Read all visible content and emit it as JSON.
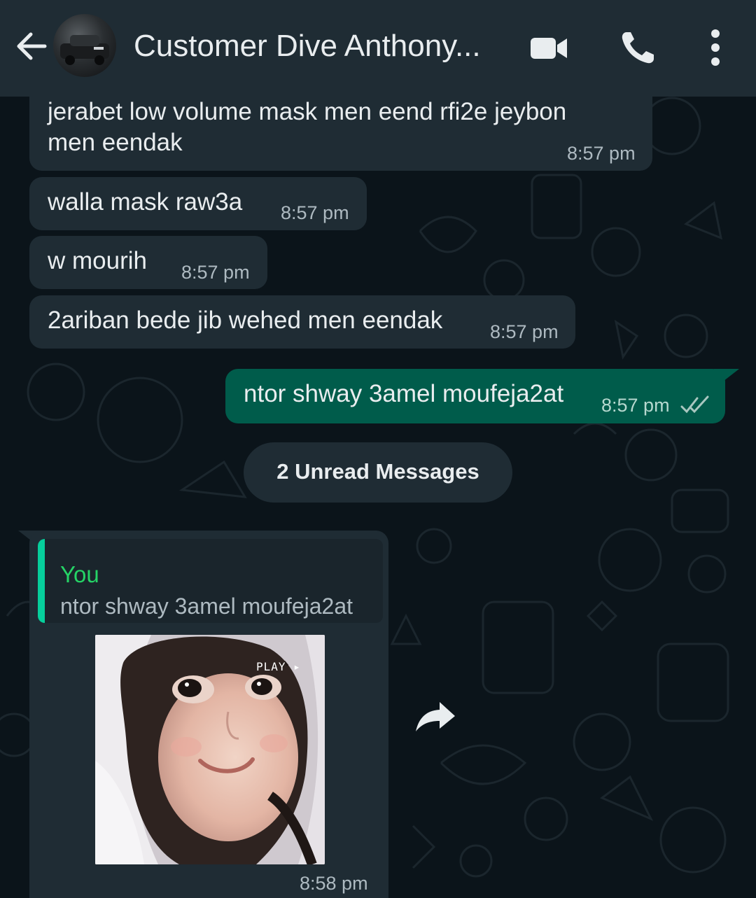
{
  "header": {
    "title": "Customer Dive Anthony...",
    "back_icon": "arrow-left-icon",
    "video_icon": "video-camera-icon",
    "call_icon": "phone-icon",
    "menu_icon": "more-vertical-icon"
  },
  "messages": [
    {
      "direction": "in",
      "text_lines": [
        "jerabet low volume mask men eend rfi2e jeybon",
        "men eendak"
      ],
      "time": "8:57 pm"
    },
    {
      "direction": "in",
      "text": "walla mask raw3a",
      "time": "8:57 pm"
    },
    {
      "direction": "in",
      "text": "w mourih",
      "time": "8:57 pm"
    },
    {
      "direction": "in",
      "text": "2ariban bede jib wehed men eendak",
      "time": "8:57 pm"
    },
    {
      "direction": "out",
      "text": "ntor shway 3amel moufeja2at",
      "time": "8:57 pm",
      "status": "read"
    }
  ],
  "unread_divider": "2 Unread Messages",
  "sticker_message": {
    "quote_author": "You",
    "quote_text": "ntor shway 3amel moufeja2at",
    "sticker_overlay_text": "PLAY",
    "time": "8:58 pm"
  },
  "colors": {
    "header_bg": "#1f2c34",
    "chat_bg": "#0b141a",
    "incoming_bubble": "#1f2c34",
    "outgoing_bubble": "#005c4b",
    "accent_green": "#25d366"
  }
}
